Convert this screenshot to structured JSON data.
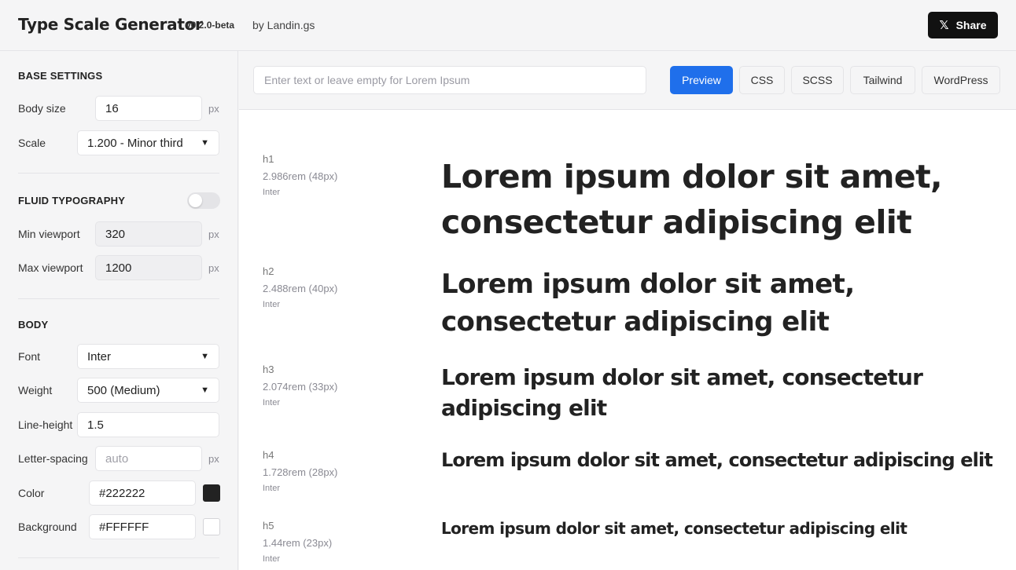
{
  "header": {
    "title": "Type Scale Generator",
    "version": "v0.2.0-beta",
    "byline": "by Landin.gs",
    "share_label": "Share",
    "share_icon": "x-logo-icon"
  },
  "sidebar": {
    "base_settings": {
      "title": "BASE SETTINGS",
      "body_size_label": "Body size",
      "body_size_value": "16",
      "body_size_unit": "px",
      "scale_label": "Scale",
      "scale_value": "1.200 - Minor third"
    },
    "fluid": {
      "title": "FLUID TYPOGRAPHY",
      "enabled": false,
      "min_viewport_label": "Min viewport",
      "min_viewport_value": "320",
      "min_viewport_unit": "px",
      "max_viewport_label": "Max viewport",
      "max_viewport_value": "1200",
      "max_viewport_unit": "px"
    },
    "body": {
      "title": "BODY",
      "font_label": "Font",
      "font_value": "Inter",
      "weight_label": "Weight",
      "weight_value": "500 (Medium)",
      "line_height_label": "Line-height",
      "line_height_value": "1.5",
      "letter_spacing_label": "Letter-spacing",
      "letter_spacing_placeholder": "auto",
      "letter_spacing_unit": "px",
      "color_label": "Color",
      "color_value": "#222222",
      "background_label": "Background",
      "background_value": "#FFFFFF"
    }
  },
  "toolbar": {
    "input_placeholder": "Enter text or leave empty for Lorem Ipsum",
    "tabs": [
      {
        "label": "Preview",
        "active": true
      },
      {
        "label": "CSS",
        "active": false
      },
      {
        "label": "SCSS",
        "active": false
      },
      {
        "label": "Tailwind",
        "active": false
      },
      {
        "label": "WordPress",
        "active": false
      }
    ]
  },
  "preview": {
    "rows": [
      {
        "tag": "h1",
        "size": "2.986rem (48px)",
        "font": "Inter",
        "text": "Lorem ipsum dolor sit amet, consectetur adipiscing elit"
      },
      {
        "tag": "h2",
        "size": "2.488rem (40px)",
        "font": "Inter",
        "text": "Lorem ipsum dolor sit amet, consectetur adipiscing elit"
      },
      {
        "tag": "h3",
        "size": "2.074rem (33px)",
        "font": "Inter",
        "text": "Lorem ipsum dolor sit amet, consectetur adipiscing elit"
      },
      {
        "tag": "h4",
        "size": "1.728rem (28px)",
        "font": "Inter",
        "text": "Lorem ipsum dolor sit amet, consectetur adipiscing elit"
      },
      {
        "tag": "h5",
        "size": "1.44rem (23px)",
        "font": "Inter",
        "text": "Lorem ipsum dolor sit amet, consectetur adipiscing elit"
      }
    ]
  },
  "colors": {
    "accent": "#1F6FEB",
    "text": "#222222",
    "background": "#FFFFFF",
    "panel": "#F5F5F6"
  }
}
